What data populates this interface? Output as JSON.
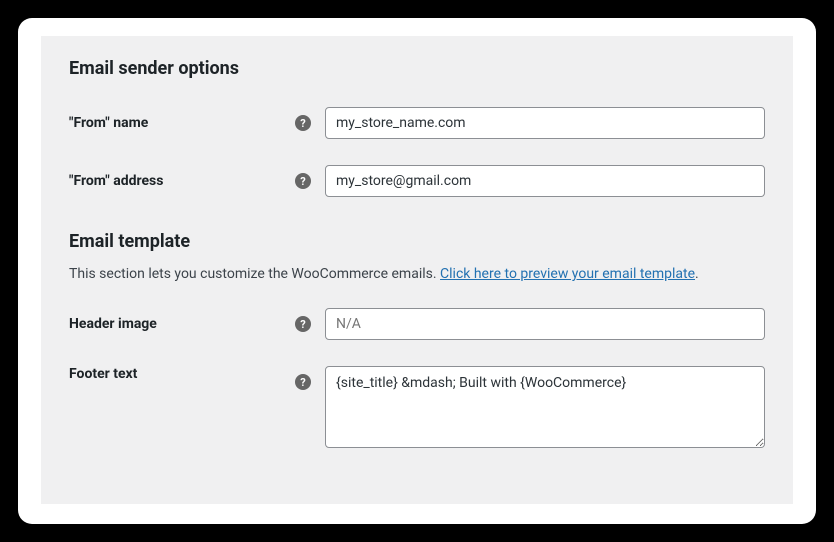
{
  "sections": {
    "sender": {
      "title": "Email sender options",
      "from_name": {
        "label": "\"From\" name",
        "value": "my_store_name.com"
      },
      "from_address": {
        "label": "\"From\" address",
        "value": "my_store@gmail.com"
      }
    },
    "template": {
      "title": "Email template",
      "description_prefix": "This section lets you customize the WooCommerce emails. ",
      "description_link": "Click here to preview your email template",
      "description_suffix": ".",
      "header_image": {
        "label": "Header image",
        "placeholder": "N/A",
        "value": ""
      },
      "footer_text": {
        "label": "Footer text",
        "value": "{site_title} &mdash; Built with {WooCommerce}"
      }
    }
  }
}
